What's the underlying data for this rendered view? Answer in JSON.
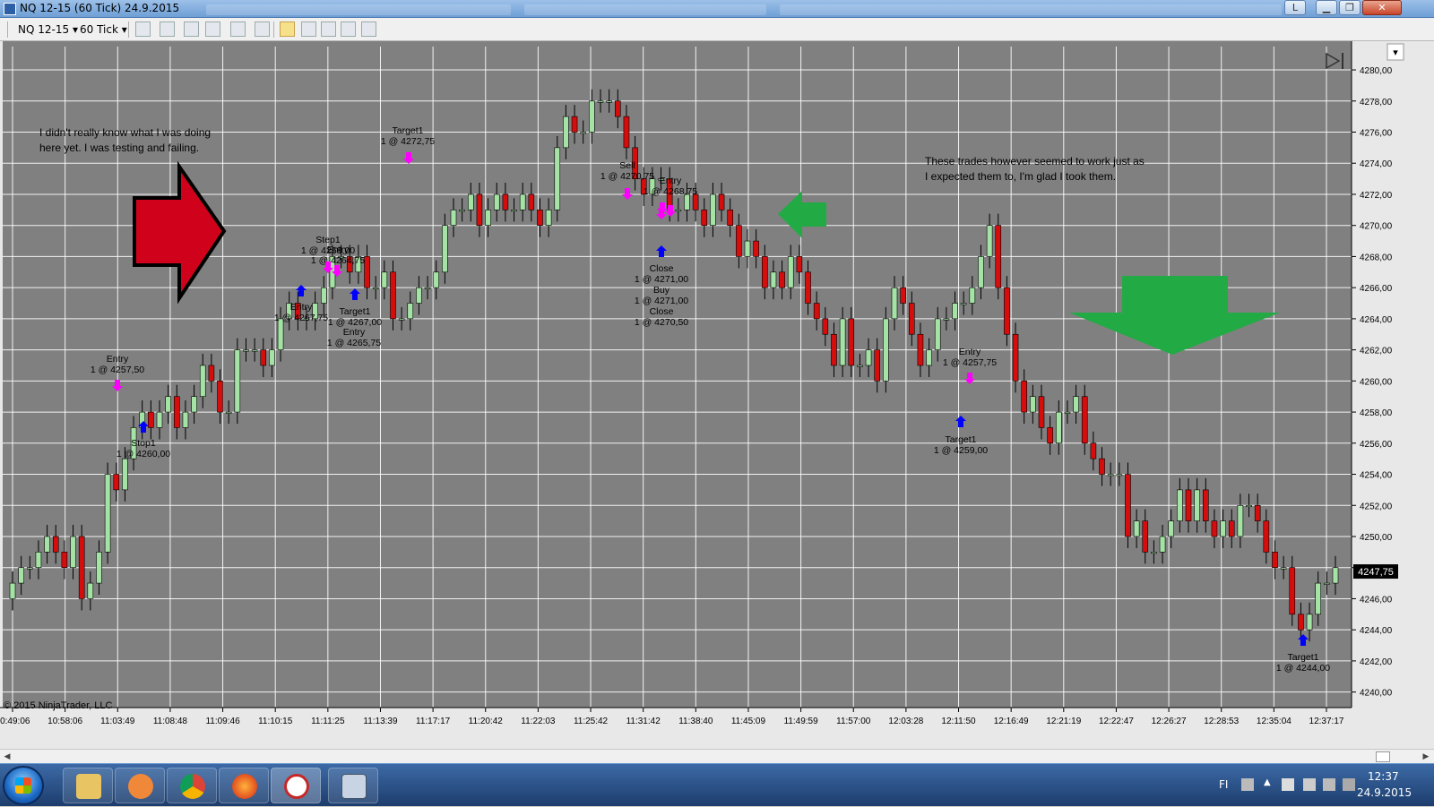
{
  "window": {
    "title": "NQ 12-15 (60 Tick)  24.9.2015",
    "layout_button": "L"
  },
  "toolbar": {
    "instrument": "NQ 12-15",
    "interval": "60 Tick"
  },
  "colors": {
    "chart_bg": "#808080",
    "up_candle": "#a5e2a5",
    "down_candle": "#d60d0d",
    "grid": "#ffffff",
    "entry_marker": "#ff00ff",
    "exit_marker": "#0000ff",
    "red_arrow": "#d0021b",
    "green_arrow": "#22aa44",
    "price_marker": "#000000"
  },
  "chart_data": {
    "type": "candlestick",
    "y_ticks": [
      "4240,00",
      "4242,00",
      "4244,00",
      "4246,00",
      "4248,00",
      "4250,00",
      "4252,00",
      "4254,00",
      "4256,00",
      "4258,00",
      "4260,00",
      "4262,00",
      "4264,00",
      "4266,00",
      "4268,00",
      "4270,00",
      "4272,00",
      "4274,00",
      "4276,00",
      "4278,00",
      "4280,00"
    ],
    "ylim": [
      4239,
      4281.5
    ],
    "x_ticks": [
      "10:49:06",
      "10:58:06",
      "11:03:49",
      "11:08:48",
      "11:09:46",
      "11:10:15",
      "11:11:25",
      "11:13:39",
      "11:17:17",
      "11:20:42",
      "11:22:03",
      "11:25:42",
      "11:31:42",
      "11:38:40",
      "11:45:09",
      "11:49:59",
      "11:57:00",
      "12:03:28",
      "12:11:50",
      "12:16:49",
      "12:21:19",
      "12:22:47",
      "12:26:27",
      "12:28:53",
      "12:35:04",
      "12:37:17"
    ],
    "last_price": "4247,75",
    "last_value": 4247.75,
    "closes": [
      4247,
      4248,
      4248,
      4249,
      4250,
      4249,
      4248,
      4250,
      4246,
      4247,
      4249,
      4254,
      4253,
      4255,
      4257,
      4258,
      4257,
      4258,
      4259,
      4257,
      4258,
      4259,
      4261,
      4260,
      4258,
      4258,
      4262,
      4262,
      4262,
      4261,
      4262,
      4264,
      4265,
      4264,
      4264,
      4265,
      4266,
      4268,
      4268,
      4267,
      4268,
      4266,
      4266,
      4267,
      4264,
      4264,
      4265,
      4266,
      4266,
      4267,
      4270,
      4271,
      4271,
      4272,
      4270,
      4271,
      4272,
      4271,
      4271,
      4272,
      4271,
      4270,
      4271,
      4275,
      4277,
      4276,
      4276,
      4278,
      4278,
      4278,
      4277,
      4275,
      4273,
      4272,
      4273,
      4273,
      4271,
      4271,
      4272,
      4271,
      4270,
      4272,
      4271,
      4270,
      4268,
      4269,
      4268,
      4266,
      4267,
      4266,
      4268,
      4267,
      4265,
      4264,
      4263,
      4261,
      4264,
      4261,
      4261,
      4262,
      4260,
      4264,
      4266,
      4265,
      4263,
      4261,
      4262,
      4264,
      4264,
      4265,
      4265,
      4266,
      4268,
      4270,
      4266,
      4263,
      4260,
      4258,
      4259,
      4257,
      4256,
      4258,
      4258,
      4259,
      4256,
      4255,
      4254,
      4254,
      4254,
      4250,
      4251,
      4249,
      4249,
      4250,
      4251,
      4253,
      4251,
      4253,
      4251,
      4250,
      4251,
      4250,
      4252,
      4252,
      4251,
      4249,
      4248,
      4248,
      4245,
      4244,
      4245,
      4247,
      4247,
      4248
    ]
  },
  "annotations": {
    "note_left_1": "I didn't really know what I was doing",
    "note_left_2": "here yet. I was testing and failing.",
    "note_right_1": "These trades however seemed to work just as",
    "note_right_2": "I expected them to, I'm glad I took them.",
    "copyright": "© 2015 NinjaTrader, LLC"
  },
  "trade_labels": [
    {
      "lines": [
        "Entry",
        "1 @ 4257,50"
      ]
    },
    {
      "lines": [
        "Stop1",
        "1 @ 4260,00"
      ]
    },
    {
      "lines": [
        "Step1",
        "1 @ 4268,00"
      ]
    },
    {
      "lines": [
        "Entry",
        "1 @ 4264,75"
      ]
    },
    {
      "lines": [
        "Entry",
        "1 @ 4267,75"
      ]
    },
    {
      "lines": [
        "Target1",
        "1 @ 4267,00"
      ]
    },
    {
      "lines": [
        "Entry",
        "1 @ 4265,75"
      ]
    },
    {
      "lines": [
        "Target1",
        "1 @ 4272,75"
      ]
    },
    {
      "lines": [
        "Sell",
        "1 @ 4270,75"
      ]
    },
    {
      "lines": [
        "Entry",
        "1 @ 4268,75"
      ]
    },
    {
      "lines": [
        "Close",
        "1 @ 4271,00"
      ]
    },
    {
      "lines": [
        "Buy",
        "1 @ 4271,00"
      ]
    },
    {
      "lines": [
        "Close",
        "1 @ 4270,50"
      ]
    },
    {
      "lines": [
        "Entry",
        "1 @ 4257,75"
      ]
    },
    {
      "lines": [
        "Target1",
        "1 @ 4259,00"
      ]
    },
    {
      "lines": [
        "Target1",
        "1 @ 4244,00"
      ]
    }
  ],
  "taskbar": {
    "lang": "FI",
    "time": "12:37",
    "date": "24.9.2015"
  }
}
